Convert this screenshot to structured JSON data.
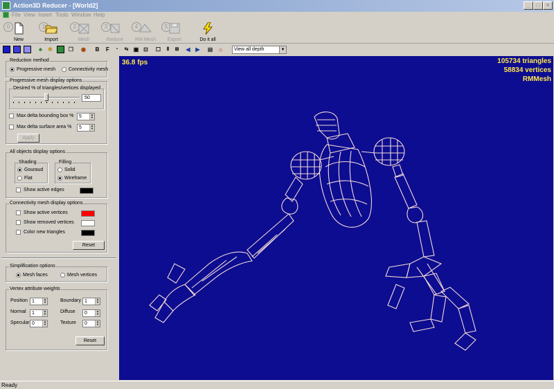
{
  "window": {
    "title": "Action3D Reducer - [World2]"
  },
  "menu": [
    "File",
    "View",
    "Insert",
    "Tools",
    "Window",
    "Help"
  ],
  "toolbar": {
    "new": "New",
    "import": "Import",
    "mesh": "Mesh",
    "reduce": "Reduce",
    "rm_mesh": "RM Mesh",
    "export": "Export",
    "do_it_all": "Do it all",
    "steps": [
      "1",
      "2",
      "3",
      "4",
      "5"
    ]
  },
  "small_toolbar": {
    "bold": "B",
    "face": "F",
    "depth_select": "View all depth"
  },
  "left_panel": {
    "reduction_method": {
      "title": "Reduction method",
      "options": [
        "Progressive mesh",
        "Connectivity mesh"
      ],
      "selected": "Progressive mesh"
    },
    "progressive": {
      "title": "Progressive mesh display options",
      "desired_title": "Desired % of triangles/vertices displayed",
      "desired_value": "50",
      "desired_fraction": 0.5,
      "max_bbox_label": "Max delta bounding box %",
      "max_bbox_value": "5",
      "max_surface_label": "Max delta surface area %",
      "max_surface_value": "5",
      "apply": "Apply"
    },
    "all_objects": {
      "title": "All objects display options",
      "shading_title": "Shading",
      "shading_options": [
        "Gouraud",
        "Flat"
      ],
      "shading_selected": "Gouraud",
      "filling_title": "Filling",
      "filling_options": [
        "Solid",
        "Wireframe"
      ],
      "filling_selected": "Wireframe",
      "show_edges": "Show active edges",
      "edges_color": "#000000"
    },
    "connectivity": {
      "title": "Connectivity mesh display options",
      "items": [
        {
          "label": "Show active vertices",
          "color": "#ff0000"
        },
        {
          "label": "Show removed vertices",
          "color": "#ffffff"
        },
        {
          "label": "Color new triangles",
          "color": "#000000"
        }
      ],
      "reset": "Reset"
    },
    "simplification": {
      "title": "Simplification options",
      "options": [
        "Mesh faces",
        "Mesh vertices"
      ],
      "selected": "Mesh faces"
    },
    "weights": {
      "title": "Vertex attribute weights",
      "position_label": "Position",
      "position_value": "1",
      "boundary_label": "Boundary",
      "boundary_value": "1",
      "normal_label": "Normal",
      "normal_value": "1",
      "diffuse_label": "Diffuse",
      "diffuse_value": "0",
      "specular_label": "Specular",
      "specular_value": "0",
      "texture_label": "Texture",
      "texture_value": "0",
      "reset": "Reset"
    }
  },
  "viewport": {
    "fps": "36.8 fps",
    "triangles": "105734 triangles",
    "vertices": "58834 vertices",
    "mesh_name": "RMMesh",
    "background": "#0d0d91",
    "hud_color": "#ffe64b",
    "wire_color": "#f3d9d6"
  },
  "status": "Ready"
}
